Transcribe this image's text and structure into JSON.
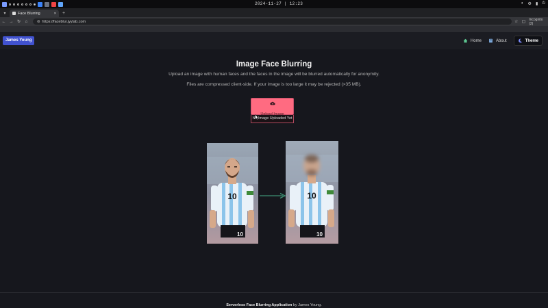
{
  "os": {
    "clock": "2024-11-27 | 12:23"
  },
  "browser": {
    "tab_title": "Face Blurring",
    "url": "https://faceblur.jyytab.com",
    "profile_label": "Incognito (2)"
  },
  "header": {
    "brand_label": "James Young",
    "nav": [
      {
        "label": "Home",
        "icon": "home-icon"
      },
      {
        "label": "About",
        "icon": "book-icon"
      },
      {
        "label": "Theme",
        "icon": "moon-icon"
      }
    ]
  },
  "main": {
    "title": "Image Face Blurring",
    "description": "Upload an image with human faces and the faces in the image will be blurred automatically for anonymity.",
    "note": "Files are compressed client-side. If your image is too large it may be rejected (>35 MB).",
    "upload_label": "Upload Image",
    "upload_icon": "cloud-upload-icon",
    "status_text": "No Image Uploaded Yet"
  },
  "footer": {
    "app_name": "Serverless Face Blurring Application",
    "byline": " by James Young."
  },
  "colors": {
    "brand": "#4152d0",
    "upload_button": "#ff6b81",
    "arrow": "#3d8f73",
    "background": "#16171d"
  }
}
